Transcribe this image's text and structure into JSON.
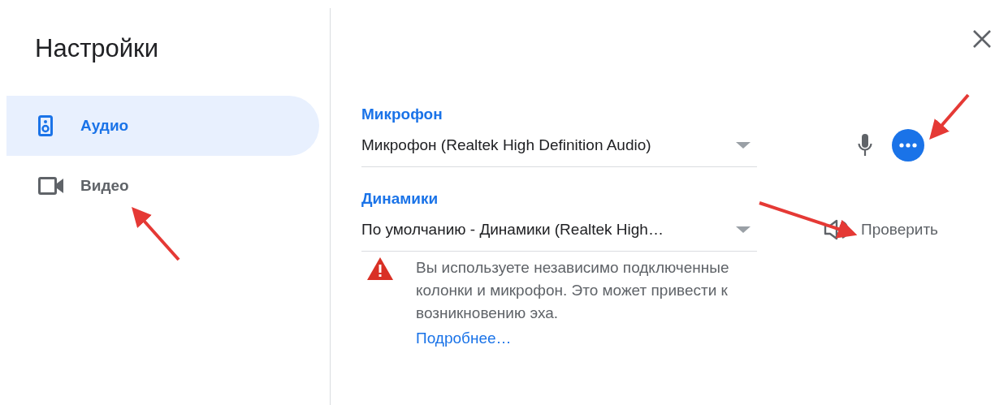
{
  "sidebar": {
    "title": "Настройки",
    "items": [
      {
        "label": "Аудио",
        "kind": "audio",
        "selected": true
      },
      {
        "label": "Видео",
        "kind": "video",
        "selected": false
      }
    ]
  },
  "devices": [
    {
      "kind": "microphone",
      "label": "Микрофон",
      "value": "Микрофон (Realtek High Definition Audio)"
    },
    {
      "kind": "speakers",
      "label": "Динамики",
      "value": "По умолчанию - Динамики (Realtek High…",
      "test_button": "Проверить",
      "warning": {
        "text": "Вы используете независимо подключенные колонки и микрофон. Это может привести к возникновению эха.",
        "link": "Подробнее…"
      }
    }
  ]
}
